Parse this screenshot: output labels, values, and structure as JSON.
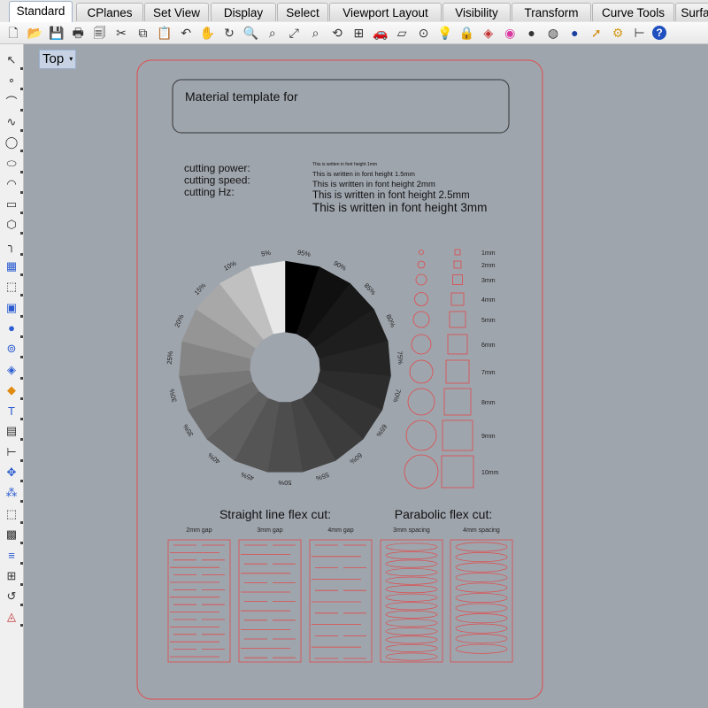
{
  "ribbon_tabs": [
    "Standard",
    "CPlanes",
    "Set View",
    "Display",
    "Select",
    "Viewport Layout",
    "Visibility",
    "Transform",
    "Curve Tools",
    "Surfa"
  ],
  "toolbar_icons": [
    "new-file",
    "open-file",
    "save",
    "print",
    "page-setup",
    "cut",
    "copy",
    "paste",
    "undo",
    "pan",
    "rotate-view",
    "zoom",
    "zoom-window",
    "zoom-extents",
    "zoom-selected",
    "rotate-camera",
    "four-viewports",
    "car-render",
    "plane",
    "point",
    "lightbulb",
    "lock",
    "material",
    "color-wheel",
    "shaded-sphere",
    "render-sphere",
    "blue-sphere",
    "select-arrow",
    "gear",
    "dimension",
    "help"
  ],
  "sidebar_icons": [
    "select",
    "point",
    "polyline",
    "curve",
    "circle",
    "ellipse",
    "arc",
    "rectangle",
    "polygon",
    "fillet",
    "surface",
    "extrude",
    "box",
    "sphere",
    "cylinder",
    "mesh",
    "solid-tools",
    "text",
    "hatch",
    "dim",
    "transform",
    "array",
    "group",
    "block",
    "layer",
    "grid",
    "history",
    "analyze"
  ],
  "viewport": {
    "name": "Top",
    "dropdown_glyph": "▾"
  },
  "template": {
    "title": "Material template for",
    "settings": [
      "cutting power:",
      "cutting speed:",
      "cutting Hz:"
    ],
    "font_samples": [
      {
        "text": "This is written in font height 1mm",
        "size": 5
      },
      {
        "text": "This is written in font height 1.5mm",
        "size": 7.5
      },
      {
        "text": "This is written in font height 2mm",
        "size": 9.5
      },
      {
        "text": "This is written in font height 2.5mm",
        "size": 11.5
      },
      {
        "text": "This is written in font height 3mm",
        "size": 13.5
      }
    ],
    "engrave_wheel": {
      "labels": [
        "95%",
        "90%",
        "85%",
        "80%",
        "75%",
        "70%",
        "65%",
        "60%",
        "55%",
        "50%",
        "45%",
        "40%",
        "35%",
        "30%",
        "25%",
        "20%",
        "15%",
        "10%",
        "5%"
      ],
      "grays": [
        "#000000",
        "#101010",
        "#181818",
        "#1e1e1e",
        "#252525",
        "#2c2c2c",
        "#343434",
        "#3c3c3c",
        "#454545",
        "#4d4d4d",
        "#555555",
        "#606060",
        "#6a6a6a",
        "#777777",
        "#858585",
        "#959595",
        "#a8a8a8",
        "#c0c0c0",
        "#e8e8e8"
      ]
    },
    "size_labels": [
      "1mm",
      "2mm",
      "3mm",
      "4mm",
      "5mm",
      "6mm",
      "7mm",
      "8mm",
      "9mm",
      "10mm"
    ],
    "flex_headings": {
      "straight": "Straight line flex cut:",
      "parabolic": "Parabolic flex cut:"
    },
    "flex_samples": [
      {
        "label": "2mm gap",
        "kind": "straight",
        "gap": 2
      },
      {
        "label": "3mm gap",
        "kind": "straight",
        "gap": 3
      },
      {
        "label": "4mm gap",
        "kind": "straight",
        "gap": 4
      },
      {
        "label": "3mm spacing",
        "kind": "parabolic",
        "gap": 3
      },
      {
        "label": "4mm spacing",
        "kind": "parabolic",
        "gap": 4
      }
    ]
  },
  "colors": {
    "cut_line": "#e04a4a",
    "viewport_bg": "#9fa5ad"
  }
}
